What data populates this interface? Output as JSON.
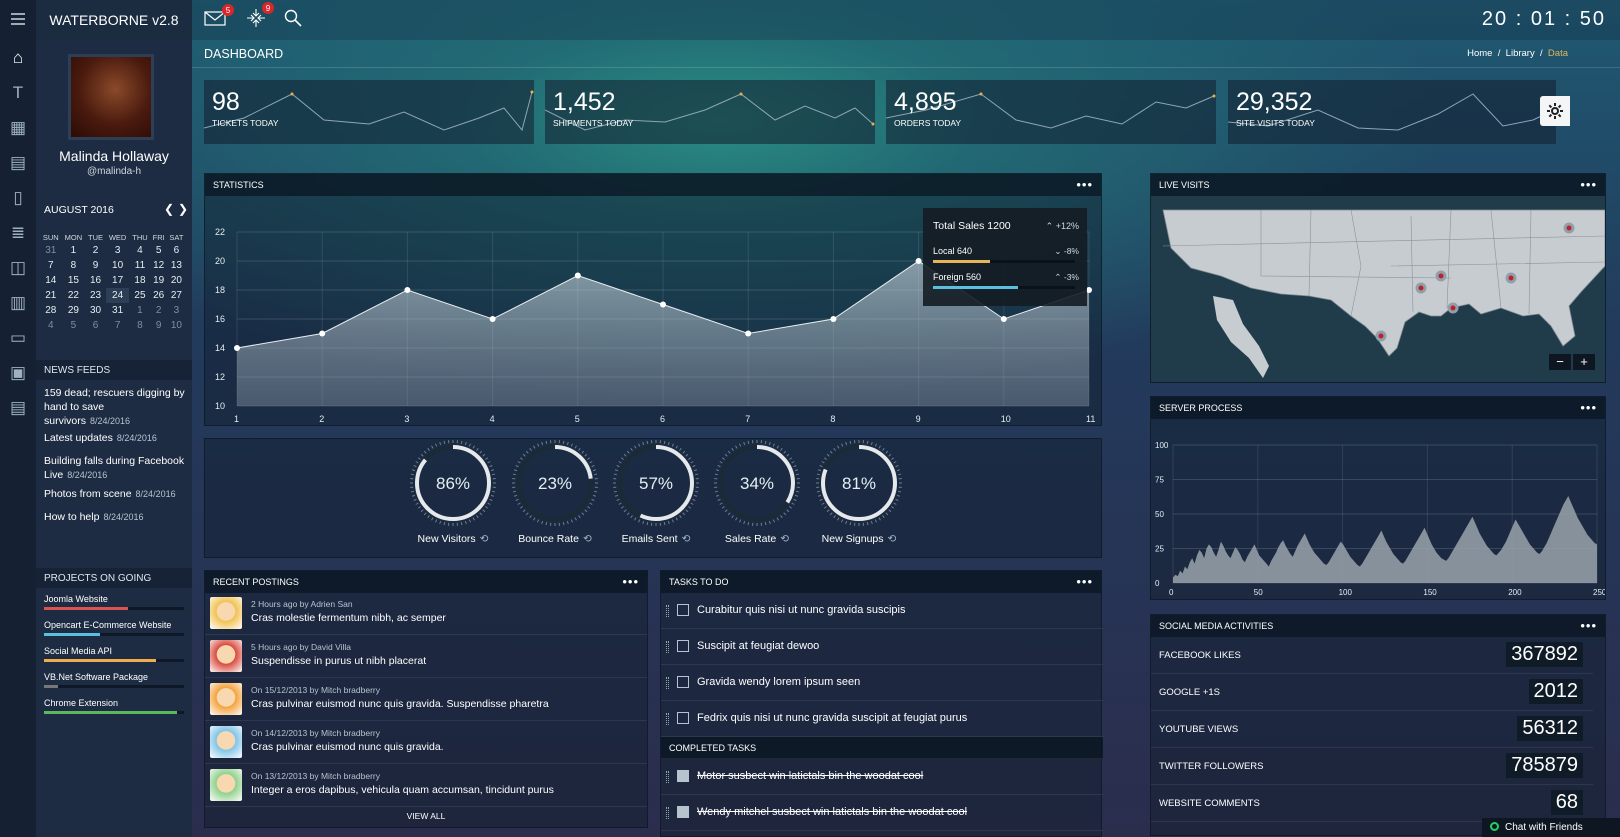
{
  "app": {
    "title": "WATERBORNE v2.8",
    "clock": "20 : 01 : 50"
  },
  "topbar": {
    "mail_badge": "5",
    "tasks_badge": "9"
  },
  "rail": {
    "icons": [
      "home-icon",
      "typography-icon",
      "grid-icon",
      "table-icon",
      "document-icon",
      "layers-icon",
      "layout-icon",
      "bar-chart-icon",
      "folder-icon",
      "calendar-icon",
      "news-icon"
    ]
  },
  "profile": {
    "name": "Malinda Hollaway",
    "handle": "@malinda-h"
  },
  "calendar": {
    "month": "AUGUST 2016",
    "weekdays": [
      "SUN",
      "MON",
      "TUE",
      "WED",
      "THU",
      "FRI",
      "SAT"
    ],
    "weeks": [
      [
        "31",
        "1",
        "2",
        "3",
        "4",
        "5",
        "6"
      ],
      [
        "7",
        "8",
        "9",
        "10",
        "11",
        "12",
        "13"
      ],
      [
        "14",
        "15",
        "16",
        "17",
        "18",
        "19",
        "20"
      ],
      [
        "21",
        "22",
        "23",
        "24",
        "25",
        "26",
        "27"
      ],
      [
        "28",
        "29",
        "30",
        "31",
        "1",
        "2",
        "3"
      ],
      [
        "4",
        "5",
        "6",
        "7",
        "8",
        "9",
        "10"
      ]
    ]
  },
  "news": {
    "title": "NEWS FEEDS",
    "items": [
      {
        "text": "159 dead; rescuers digging by hand to save survivors",
        "date": "8/24/2016"
      },
      {
        "text": "Latest updates",
        "date": "8/24/2016"
      },
      {
        "text": "Building falls during Facebook Live",
        "date": "8/24/2016"
      },
      {
        "text": "Photos from scene",
        "date": "8/24/2016"
      },
      {
        "text": "How to help",
        "date": "8/24/2016"
      }
    ]
  },
  "projects": {
    "title": "PROJECTS ON GOING",
    "items": [
      {
        "name": "Joomla Website",
        "progress": 0.6,
        "color": "#d9534f"
      },
      {
        "name": "Opencart E-Commerce Website",
        "progress": 0.4,
        "color": "#5bc0de"
      },
      {
        "name": "Social Media API",
        "progress": 0.8,
        "color": "#f0ad4e"
      },
      {
        "name": "VB.Net Software Package",
        "progress": 0.1,
        "color": "#777777"
      },
      {
        "name": "Chrome Extension",
        "progress": 0.95,
        "color": "#5cb85c"
      }
    ]
  },
  "page": {
    "title": "DASHBOARD",
    "breadcrumb": [
      "Home",
      "Library",
      "Data"
    ]
  },
  "kpis": [
    {
      "value": "98",
      "label": "TICKETS TODAY"
    },
    {
      "value": "1,452",
      "label": "SHIPMENTS TODAY"
    },
    {
      "value": "4,895",
      "label": "ORDERS TODAY"
    },
    {
      "value": "29,352",
      "label": "SITE VISITS TODAY"
    }
  ],
  "statistics": {
    "title": "STATISTICS",
    "summary": {
      "total": "Total Sales 1200",
      "total_change": "+12%",
      "local": "Local 640",
      "local_change": "-8%",
      "local_progress": 0.4,
      "foreign": "Foreign 560",
      "foreign_change": "-3%",
      "foreign_progress": 0.6
    }
  },
  "gauges": [
    {
      "value": "86%",
      "label": "New Visitors",
      "pct": 0.86
    },
    {
      "value": "23%",
      "label": "Bounce Rate",
      "pct": 0.23
    },
    {
      "value": "57%",
      "label": "Emails Sent",
      "pct": 0.57
    },
    {
      "value": "34%",
      "label": "Sales Rate",
      "pct": 0.34
    },
    {
      "value": "81%",
      "label": "New Signups",
      "pct": 0.81
    }
  ],
  "postings": {
    "title": "RECENT POSTINGS",
    "view_all": "VIEW ALL",
    "items": [
      {
        "meta": "2 Hours ago by Adrien San",
        "text": "Cras molestie fermentum nibh, ac semper",
        "color": "#f2c14e"
      },
      {
        "meta": "5 Hours ago by David Villa",
        "text": "Suspendisse in purus ut nibh placerat",
        "color": "#d94a3d"
      },
      {
        "meta": "On 15/12/2013 by Mitch bradberry",
        "text": "Cras pulvinar euismod nunc quis gravida. Suspendisse pharetra",
        "color": "#f4a23a"
      },
      {
        "meta": "On 14/12/2013 by Mitch bradberry",
        "text": "Cras pulvinar euismod nunc quis gravida.",
        "color": "#7fc4e8"
      },
      {
        "meta": "On 13/12/2013 by Mitch bradberry",
        "text": "Integer a eros dapibus, vehicula quam accumsan, tincidunt purus",
        "color": "#8fd18a"
      }
    ]
  },
  "tasks": {
    "title": "TASKS TO DO",
    "items": [
      "Curabitur quis nisi ut nunc gravida suscipis",
      "Suscipit at feugiat dewoo",
      "Gravida wendy lorem ipsum seen",
      "Fedrix quis nisi ut nunc gravida suscipit at feugiat purus"
    ],
    "completed_title": "COMPLETED TASKS",
    "completed": [
      "Motor susbect win latictals bin the woodat cool",
      "Wendy mitchel susbect win latictals bin the woodat cool"
    ]
  },
  "live_visits": {
    "title": "LIVE VISITS",
    "zoom_out": "−",
    "zoom_in": "+"
  },
  "server": {
    "title": "SERVER PROCESS"
  },
  "social": {
    "title": "SOCIAL MEDIA ACTIVITIES",
    "items": [
      {
        "label": "FACEBOOK LIKES",
        "value": "367892"
      },
      {
        "label": "GOOGLE +1s",
        "value": "2012"
      },
      {
        "label": "YOUTUBE VIEWS",
        "value": "56312"
      },
      {
        "label": "TWITTER FOLLOWERS",
        "value": "785879"
      },
      {
        "label": "WEBSITE COMMENTS",
        "value": "68"
      }
    ]
  },
  "chat": {
    "label": "Chat with Friends"
  },
  "chart_data": [
    {
      "type": "area",
      "name": "statistics",
      "x": [
        1,
        2,
        3,
        4,
        5,
        6,
        7,
        8,
        9,
        10,
        11
      ],
      "values": [
        14,
        15,
        18,
        16,
        19,
        17,
        15,
        16,
        20,
        16,
        18
      ],
      "ylim": [
        10,
        22
      ],
      "yticks": [
        10,
        12,
        14,
        16,
        18,
        20,
        22
      ],
      "grid": true
    },
    {
      "type": "area",
      "name": "server_process",
      "xlim": [
        0,
        250
      ],
      "ylim": [
        0,
        100
      ],
      "xticks": [
        0,
        50,
        100,
        150,
        200,
        250
      ],
      "yticks": [
        0,
        25,
        50,
        75,
        100
      ],
      "grid": true,
      "values": [
        4,
        6,
        5,
        9,
        7,
        12,
        10,
        15,
        18,
        14,
        20,
        24,
        22,
        18,
        25,
        28,
        26,
        22,
        19,
        24,
        30,
        27,
        23,
        20,
        18,
        22,
        26,
        24,
        21,
        17,
        15,
        19,
        22,
        25,
        28,
        24,
        20,
        18,
        16,
        14,
        12,
        16,
        19,
        22,
        26,
        29,
        31,
        27,
        24,
        21,
        19,
        23,
        27,
        30,
        33,
        36,
        32,
        28,
        25,
        22,
        20,
        18,
        16,
        14,
        13,
        15,
        18,
        21,
        24,
        27,
        30,
        28,
        25,
        22,
        19,
        17,
        15,
        13,
        12,
        14,
        17,
        20,
        23,
        26,
        29,
        32,
        35,
        38,
        34,
        30,
        27,
        24,
        21,
        19,
        17,
        15,
        14,
        16,
        19,
        22,
        25,
        28,
        31,
        34,
        37,
        40,
        36,
        32,
        28,
        25,
        22,
        20,
        18,
        17,
        16,
        18,
        21,
        24,
        27,
        30,
        33,
        36,
        39,
        42,
        45,
        48,
        44,
        40,
        36,
        33,
        30,
        27,
        25,
        23,
        21,
        20,
        22,
        24,
        27,
        30,
        34,
        38,
        42,
        46,
        43,
        40,
        37,
        34,
        31,
        28,
        26,
        24,
        22,
        21,
        23,
        26,
        29,
        33,
        37,
        41,
        45,
        49,
        53,
        57,
        60,
        63,
        59,
        55,
        51,
        47,
        44,
        41,
        38,
        35,
        33,
        31,
        29,
        28
      ]
    }
  ]
}
